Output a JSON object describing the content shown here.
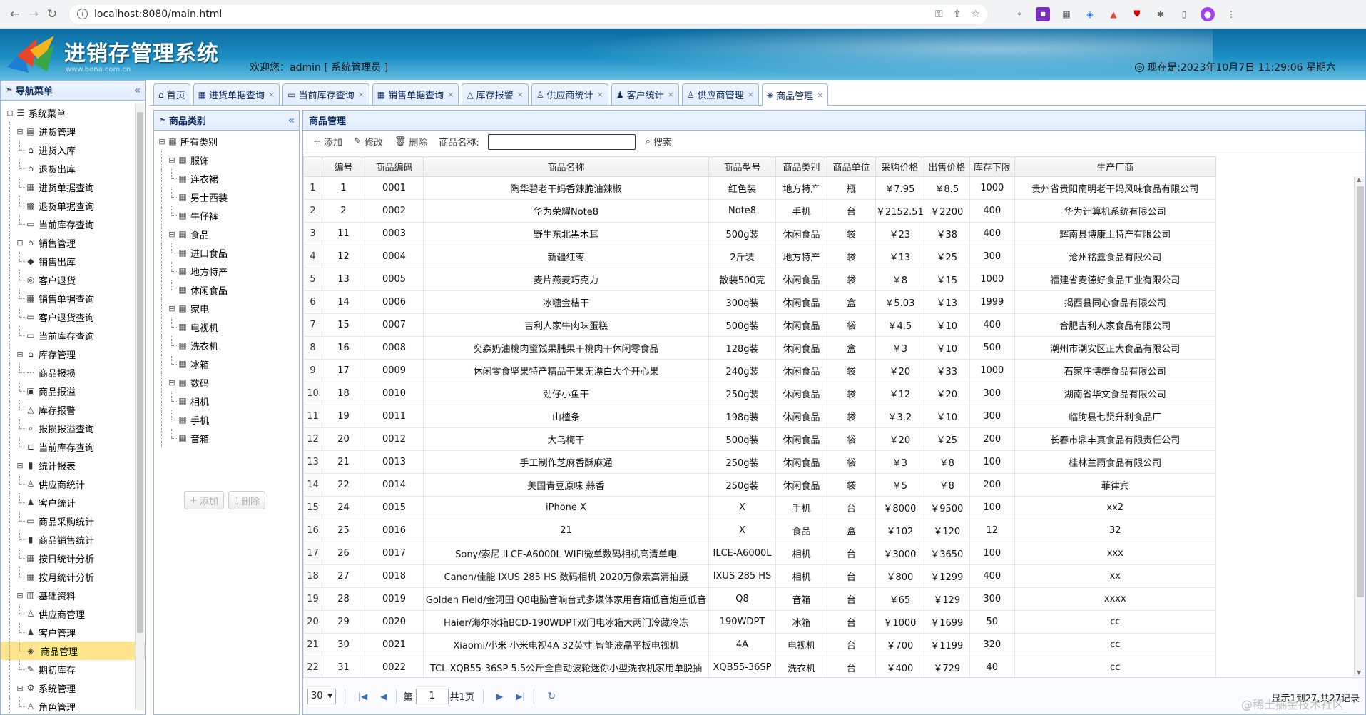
{
  "browser": {
    "url": "localhost:8080/main.html"
  },
  "header": {
    "title": "进销存管理系统",
    "url_text": "www.bona.com.cn",
    "welcome": "欢迎您：admin [ 系统管理员 ]",
    "clock": "现在是:2023年10月7日 11:29:06 星期六"
  },
  "nav": {
    "title": "导航菜单",
    "items": [
      {
        "label": "系统菜单",
        "level": 0,
        "kind": "root",
        "icon": "menu-icon"
      },
      {
        "label": "进货管理",
        "level": 1,
        "kind": "group",
        "icon": "doc-icon"
      },
      {
        "label": "进货入库",
        "level": 2,
        "kind": "leaf",
        "icon": "warehouse-icon"
      },
      {
        "label": "退货出库",
        "level": 2,
        "kind": "leaf",
        "icon": "warehouse-icon"
      },
      {
        "label": "进货单据查询",
        "level": 2,
        "kind": "leaf",
        "icon": "list-icon"
      },
      {
        "label": "退货单据查询",
        "level": 2,
        "kind": "leaf",
        "icon": "calc-icon"
      },
      {
        "label": "当前库存查询",
        "level": 2,
        "kind": "leaf",
        "icon": "window-icon"
      },
      {
        "label": "销售管理",
        "level": 1,
        "kind": "group",
        "icon": "home-icon"
      },
      {
        "label": "销售出库",
        "level": 2,
        "kind": "leaf",
        "icon": "tag-icon"
      },
      {
        "label": "客户退货",
        "level": 2,
        "kind": "leaf",
        "icon": "return-icon"
      },
      {
        "label": "销售单据查询",
        "level": 2,
        "kind": "leaf",
        "icon": "list-icon"
      },
      {
        "label": "客户退货查询",
        "level": 2,
        "kind": "leaf",
        "icon": "window-icon"
      },
      {
        "label": "当前库存查询",
        "level": 2,
        "kind": "leaf",
        "icon": "window-icon"
      },
      {
        "label": "库存管理",
        "level": 1,
        "kind": "group",
        "icon": "home-icon"
      },
      {
        "label": "商品报损",
        "level": 2,
        "kind": "leaf",
        "icon": "break-icon"
      },
      {
        "label": "商品报溢",
        "level": 2,
        "kind": "leaf",
        "icon": "image-icon"
      },
      {
        "label": "库存报警",
        "level": 2,
        "kind": "leaf",
        "icon": "warning-icon"
      },
      {
        "label": "报损报溢查询",
        "level": 2,
        "kind": "leaf",
        "icon": "search-icon"
      },
      {
        "label": "当前库存查询",
        "level": 2,
        "kind": "leaf",
        "icon": "tree-icon"
      },
      {
        "label": "统计报表",
        "level": 1,
        "kind": "group",
        "icon": "barchart-icon"
      },
      {
        "label": "供应商统计",
        "level": 2,
        "kind": "leaf",
        "icon": "user-icon"
      },
      {
        "label": "客户统计",
        "level": 2,
        "kind": "leaf",
        "icon": "users-icon"
      },
      {
        "label": "商品采购统计",
        "level": 2,
        "kind": "leaf",
        "icon": "window-icon"
      },
      {
        "label": "商品销售统计",
        "level": 2,
        "kind": "leaf",
        "icon": "barchart-icon"
      },
      {
        "label": "按日统计分析",
        "level": 2,
        "kind": "leaf",
        "icon": "list-icon"
      },
      {
        "label": "按月统计分析",
        "level": 2,
        "kind": "leaf",
        "icon": "list-icon"
      },
      {
        "label": "基础资料",
        "level": 1,
        "kind": "group",
        "icon": "book-icon"
      },
      {
        "label": "供应商管理",
        "level": 2,
        "kind": "leaf",
        "icon": "user-icon"
      },
      {
        "label": "客户管理",
        "level": 2,
        "kind": "leaf",
        "icon": "users-icon"
      },
      {
        "label": "商品管理",
        "level": 2,
        "kind": "leaf",
        "icon": "box-icon",
        "selected": true
      },
      {
        "label": "期初库存",
        "level": 2,
        "kind": "leaf",
        "icon": "edit-icon"
      },
      {
        "label": "系统管理",
        "level": 1,
        "kind": "group",
        "icon": "gear-icon"
      },
      {
        "label": "角色管理",
        "level": 2,
        "kind": "leaf",
        "icon": "user-icon"
      }
    ]
  },
  "tabs": [
    {
      "label": "首页",
      "icon": "home-icon",
      "closable": false
    },
    {
      "label": "进货单据查询",
      "icon": "list-icon",
      "closable": true
    },
    {
      "label": "当前库存查询",
      "icon": "window-icon",
      "closable": true
    },
    {
      "label": "销售单据查询",
      "icon": "list-icon",
      "closable": true
    },
    {
      "label": "库存报警",
      "icon": "warning-icon",
      "closable": true
    },
    {
      "label": "供应商统计",
      "icon": "user-icon",
      "closable": true
    },
    {
      "label": "客户统计",
      "icon": "users-icon",
      "closable": true
    },
    {
      "label": "供应商管理",
      "icon": "user-icon",
      "closable": true
    },
    {
      "label": "商品管理",
      "icon": "box-icon",
      "closable": true,
      "active": true
    }
  ],
  "category_panel": {
    "title": "商品类别",
    "tree": [
      {
        "label": "所有类别",
        "level": 0,
        "kind": "group"
      },
      {
        "label": "服饰",
        "level": 1,
        "kind": "group"
      },
      {
        "label": "连衣裙",
        "level": 2,
        "kind": "leaf"
      },
      {
        "label": "男士西装",
        "level": 2,
        "kind": "leaf"
      },
      {
        "label": "牛仔裤",
        "level": 2,
        "kind": "leaf"
      },
      {
        "label": "食品",
        "level": 1,
        "kind": "group"
      },
      {
        "label": "进口食品",
        "level": 2,
        "kind": "leaf"
      },
      {
        "label": "地方特产",
        "level": 2,
        "kind": "leaf"
      },
      {
        "label": "休闲食品",
        "level": 2,
        "kind": "leaf"
      },
      {
        "label": "家电",
        "level": 1,
        "kind": "group"
      },
      {
        "label": "电视机",
        "level": 2,
        "kind": "leaf"
      },
      {
        "label": "洗衣机",
        "level": 2,
        "kind": "leaf"
      },
      {
        "label": "冰箱",
        "level": 2,
        "kind": "leaf"
      },
      {
        "label": "数码",
        "level": 1,
        "kind": "group"
      },
      {
        "label": "相机",
        "level": 2,
        "kind": "leaf"
      },
      {
        "label": "手机",
        "level": 2,
        "kind": "leaf"
      },
      {
        "label": "音箱",
        "level": 2,
        "kind": "leaf"
      }
    ],
    "add_label": "添加",
    "delete_label": "删除"
  },
  "goods": {
    "title": "商品管理",
    "toolbar": {
      "add": "添加",
      "edit": "修改",
      "delete": "删除",
      "name_label": "商品名称:",
      "name_value": "",
      "search": "搜索"
    },
    "columns": [
      "编号",
      "商品编码",
      "商品名称",
      "商品型号",
      "商品类别",
      "商品单位",
      "采购价格",
      "出售价格",
      "库存下限",
      "生产厂商"
    ],
    "rows": [
      [
        "1",
        "0001",
        "陶华碧老干妈香辣脆油辣椒",
        "红色装",
        "地方特产",
        "瓶",
        "￥7.95",
        "￥8.5",
        "1000",
        "贵州省贵阳南明老干妈风味食品有限公司"
      ],
      [
        "2",
        "0002",
        "华为荣耀Note8",
        "Note8",
        "手机",
        "台",
        "￥2152.51",
        "￥2200",
        "400",
        "华为计算机系统有限公司"
      ],
      [
        "11",
        "0003",
        "野生东北黑木耳",
        "500g装",
        "休闲食品",
        "袋",
        "￥23",
        "￥38",
        "400",
        "辉南县博康土特产有限公司"
      ],
      [
        "12",
        "0004",
        "新疆红枣",
        "2斤装",
        "地方特产",
        "袋",
        "￥13",
        "￥25",
        "300",
        "沧州铭鑫食品有限公司"
      ],
      [
        "13",
        "0005",
        "麦片燕麦巧克力",
        "散装500克",
        "休闲食品",
        "袋",
        "￥8",
        "￥15",
        "1000",
        "福建省麦德好食品工业有限公司"
      ],
      [
        "14",
        "0006",
        "冰糖金桔干",
        "300g装",
        "休闲食品",
        "盒",
        "￥5.03",
        "￥13",
        "1999",
        "揭西县同心食品有限公司"
      ],
      [
        "15",
        "0007",
        "吉利人家牛肉味蛋糕",
        "500g装",
        "休闲食品",
        "袋",
        "￥4.5",
        "￥10",
        "400",
        "合肥吉利人家食品有限公司"
      ],
      [
        "16",
        "0008",
        "奕森奶油桃肉蜜饯果脯果干桃肉干休闲零食品",
        "128g装",
        "休闲食品",
        "盒",
        "￥3",
        "￥10",
        "500",
        "潮州市潮安区正大食品有限公司"
      ],
      [
        "17",
        "0009",
        "休闲零食坚果特产精品干果无漂白大个开心果",
        "240g装",
        "休闲食品",
        "袋",
        "￥20",
        "￥33",
        "1000",
        "石家庄博群食品有限公司"
      ],
      [
        "18",
        "0010",
        "劲仔小鱼干",
        "250g装",
        "休闲食品",
        "袋",
        "￥12",
        "￥20",
        "300",
        "湖南省华文食品有限公司"
      ],
      [
        "19",
        "0011",
        "山楂条",
        "198g装",
        "休闲食品",
        "袋",
        "￥3.2",
        "￥10",
        "300",
        "临朐县七贤升利食品厂"
      ],
      [
        "20",
        "0012",
        "大乌梅干",
        "500g装",
        "休闲食品",
        "袋",
        "￥20",
        "￥25",
        "200",
        "长春市鼎丰真食品有限责任公司"
      ],
      [
        "21",
        "0013",
        "手工制作芝麻香酥麻通",
        "250g装",
        "休闲食品",
        "袋",
        "￥3",
        "￥8",
        "100",
        "桂林兰雨食品有限公司"
      ],
      [
        "22",
        "0014",
        "美国青豆原味 蒜香",
        "250g装",
        "休闲食品",
        "袋",
        "￥5",
        "￥8",
        "200",
        "菲律宾"
      ],
      [
        "24",
        "0015",
        "iPhone X",
        "X",
        "手机",
        "台",
        "￥8000",
        "￥9500",
        "100",
        "xx2"
      ],
      [
        "25",
        "0016",
        "21",
        "X",
        "食品",
        "盒",
        "￥102",
        "￥120",
        "12",
        "32"
      ],
      [
        "26",
        "0017",
        "Sony/索尼 ILCE-A6000L WIFI微单数码相机高清单电",
        "ILCE-A6000L",
        "相机",
        "台",
        "￥3000",
        "￥3650",
        "100",
        "xxx"
      ],
      [
        "27",
        "0018",
        "Canon/佳能 IXUS 285 HS 数码相机 2020万像素高清拍摄",
        "IXUS 285 HS",
        "相机",
        "台",
        "￥800",
        "￥1299",
        "400",
        "xx"
      ],
      [
        "28",
        "0019",
        "Golden Field/金河田 Q8电脑音响台式多媒体家用音箱低音炮重低音",
        "Q8",
        "音箱",
        "台",
        "￥65",
        "￥129",
        "300",
        "xxxx"
      ],
      [
        "29",
        "0020",
        "Haier/海尔冰箱BCD-190WDPT双门电冰箱大两门冷藏冷冻",
        "190WDPT",
        "冰箱",
        "台",
        "￥1000",
        "￥1699",
        "50",
        "cc"
      ],
      [
        "30",
        "0021",
        "Xiaomi/小米 小米电视4A 32英寸 智能液晶平板电视机",
        "4A",
        "电视机",
        "台",
        "￥700",
        "￥1199",
        "320",
        "cc"
      ],
      [
        "31",
        "0022",
        "TCL XQB55-36SP 5.5公斤全自动波轮迷你小型洗衣机家用单脱抽",
        "XQB55-36SP",
        "洗衣机",
        "台",
        "￥400",
        "￥729",
        "40",
        "cc"
      ]
    ]
  },
  "pager": {
    "page_size": "30",
    "page_label": "第",
    "page_value": "1",
    "total_pages": "共1页",
    "summary": "显示1到27,共27记录"
  },
  "watermark": "@稀土掘金技术社区"
}
